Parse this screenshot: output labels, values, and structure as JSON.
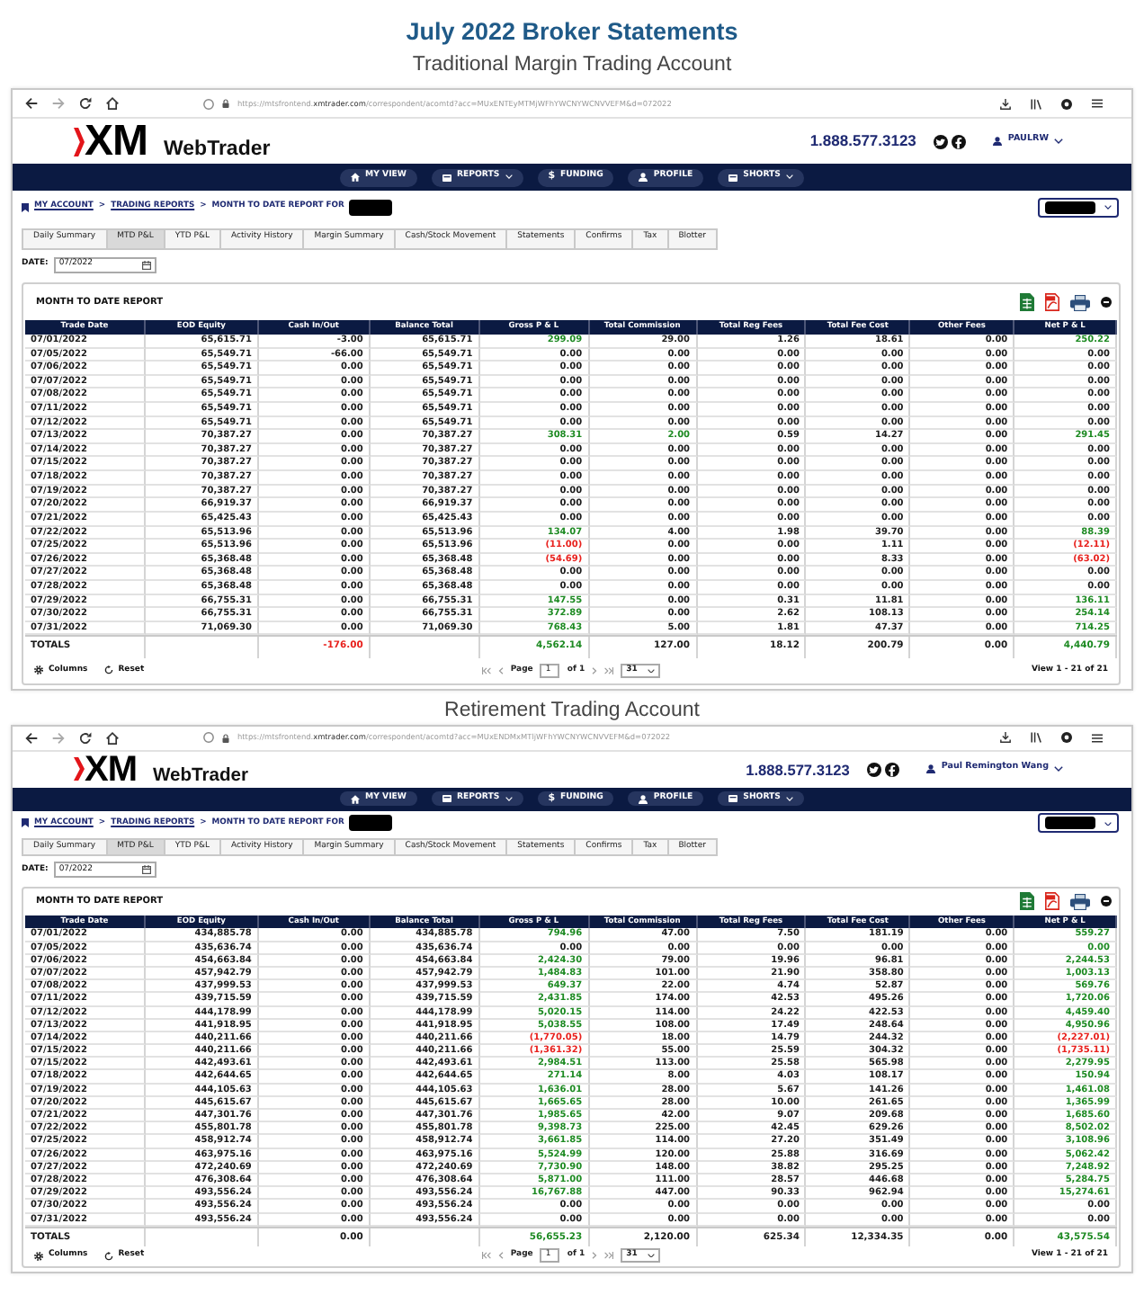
{
  "heading": "July 2022 Broker Statements",
  "statements": [
    {
      "caption": "Traditional Margin Trading Account",
      "browser": {
        "url_host": "https://mtsfrontend.",
        "url_domain": "xmtrader.com",
        "url_path": "/correspondent/acomtd?acc=MUxENTEyMTMjWFhYWCNYWCNVVEFM&d=072022"
      },
      "site": {
        "brand": "XM",
        "product": "WebTrader",
        "phone": "1.888.577.3123",
        "user": "PAULRW"
      },
      "nav": [
        {
          "label": "MY VIEW",
          "dropdown": false
        },
        {
          "label": "REPORTS",
          "dropdown": true
        },
        {
          "label": "FUNDING",
          "glyph": "$",
          "dropdown": false
        },
        {
          "label": "PROFILE",
          "dropdown": false
        },
        {
          "label": "SHORTS",
          "dropdown": true
        }
      ],
      "breadcrumb": [
        {
          "kind": "link",
          "text": "MY ACCOUNT"
        },
        {
          "kind": "separator",
          "text": ">"
        },
        {
          "kind": "link",
          "text": "TRADING REPORTS"
        },
        {
          "kind": "separator",
          "text": ">"
        },
        {
          "kind": "text",
          "text": "MONTH TO DATE REPORT FOR"
        }
      ],
      "tabs": [
        {
          "label": "Daily Summary",
          "selected": false
        },
        {
          "label": "MTD P&L",
          "selected": true
        },
        {
          "label": "YTD P&L",
          "selected": false
        },
        {
          "label": "Activity History",
          "selected": false
        },
        {
          "label": "Margin Summary",
          "selected": false
        },
        {
          "label": "Cash/Stock Movement",
          "selected": false
        },
        {
          "label": "Statements",
          "selected": false
        },
        {
          "label": "Confirms",
          "selected": false
        },
        {
          "label": "Tax",
          "selected": false
        },
        {
          "label": "Blotter",
          "selected": false
        }
      ],
      "date": {
        "label": "DATE:",
        "value": "07/2022"
      },
      "report": {
        "title": "MONTH TO DATE REPORT",
        "columns": [
          "Trade Date",
          "EOD Equity",
          "Cash In/Out",
          "Balance Total",
          "Gross P & L",
          "Total Commission",
          "Total Reg Fees",
          "Total Fee Cost",
          "Other Fees",
          "Net P & L"
        ],
        "rows": [
          [
            "07/01/2022",
            "65,615.71",
            "-3.00",
            "65,615.71",
            {
              "text": "299.09",
              "color": "#1d8a22"
            },
            "29.00",
            "1.26",
            "18.61",
            "0.00",
            {
              "text": "250.22",
              "color": "#1d8a22"
            }
          ],
          [
            "07/05/2022",
            "65,549.71",
            "-66.00",
            "65,549.71",
            "0.00",
            "0.00",
            "0.00",
            "0.00",
            "0.00",
            "0.00"
          ],
          [
            "07/06/2022",
            "65,549.71",
            "0.00",
            "65,549.71",
            "0.00",
            "0.00",
            "0.00",
            "0.00",
            "0.00",
            "0.00"
          ],
          [
            "07/07/2022",
            "65,549.71",
            "0.00",
            "65,549.71",
            "0.00",
            "0.00",
            "0.00",
            "0.00",
            "0.00",
            "0.00"
          ],
          [
            "07/08/2022",
            "65,549.71",
            "0.00",
            "65,549.71",
            "0.00",
            "0.00",
            "0.00",
            "0.00",
            "0.00",
            "0.00"
          ],
          [
            "07/11/2022",
            "65,549.71",
            "0.00",
            "65,549.71",
            "0.00",
            "0.00",
            "0.00",
            "0.00",
            "0.00",
            "0.00"
          ],
          [
            "07/12/2022",
            "65,549.71",
            "0.00",
            "65,549.71",
            "0.00",
            "0.00",
            "0.00",
            "0.00",
            "0.00",
            "0.00"
          ],
          [
            "07/13/2022",
            "70,387.27",
            "0.00",
            "70,387.27",
            {
              "text": "308.31",
              "color": "#1d8a22"
            },
            {
              "text": "2.00",
              "color": "#1d8a22"
            },
            "0.59",
            "14.27",
            "0.00",
            {
              "text": "291.45",
              "color": "#1d8a22"
            }
          ],
          [
            "07/14/2022",
            "70,387.27",
            "0.00",
            "70,387.27",
            "0.00",
            "0.00",
            "0.00",
            "0.00",
            "0.00",
            "0.00"
          ],
          [
            "07/15/2022",
            "70,387.27",
            "0.00",
            "70,387.27",
            "0.00",
            "0.00",
            "0.00",
            "0.00",
            "0.00",
            "0.00"
          ],
          [
            "07/18/2022",
            "70,387.27",
            "0.00",
            "70,387.27",
            "0.00",
            "0.00",
            "0.00",
            "0.00",
            "0.00",
            "0.00"
          ],
          [
            "07/19/2022",
            "70,387.27",
            "0.00",
            "70,387.27",
            "0.00",
            "0.00",
            "0.00",
            "0.00",
            "0.00",
            "0.00"
          ],
          [
            "07/20/2022",
            "66,919.37",
            "0.00",
            "66,919.37",
            "0.00",
            "0.00",
            "0.00",
            "0.00",
            "0.00",
            "0.00"
          ],
          [
            "07/21/2022",
            "65,425.43",
            "0.00",
            "65,425.43",
            "0.00",
            "0.00",
            "0.00",
            "0.00",
            "0.00",
            "0.00"
          ],
          [
            "07/22/2022",
            "65,513.96",
            "0.00",
            "65,513.96",
            {
              "text": "134.07",
              "color": "#1d8a22"
            },
            "4.00",
            "1.98",
            "39.70",
            "0.00",
            {
              "text": "88.39",
              "color": "#1d8a22"
            }
          ],
          [
            "07/25/2022",
            "65,513.96",
            "0.00",
            "65,513.96",
            {
              "text": "(11.00)",
              "color": "#e8211d"
            },
            "0.00",
            "0.00",
            "1.11",
            "0.00",
            {
              "text": "(12.11)",
              "color": "#e8211d"
            }
          ],
          [
            "07/26/2022",
            "65,368.48",
            "0.00",
            "65,368.48",
            {
              "text": "(54.69)",
              "color": "#e8211d"
            },
            "0.00",
            "0.00",
            "8.33",
            "0.00",
            {
              "text": "(63.02)",
              "color": "#e8211d"
            }
          ],
          [
            "07/27/2022",
            "65,368.48",
            "0.00",
            "65,368.48",
            "0.00",
            "0.00",
            "0.00",
            "0.00",
            "0.00",
            "0.00"
          ],
          [
            "07/28/2022",
            "65,368.48",
            "0.00",
            "65,368.48",
            "0.00",
            "0.00",
            "0.00",
            "0.00",
            "0.00",
            "0.00"
          ],
          [
            "07/29/2022",
            "66,755.31",
            "0.00",
            "66,755.31",
            {
              "text": "147.55",
              "color": "#1d8a22"
            },
            "0.00",
            "0.31",
            "11.81",
            "0.00",
            {
              "text": "136.11",
              "color": "#1d8a22"
            }
          ],
          [
            "07/30/2022",
            "66,755.31",
            "0.00",
            "66,755.31",
            {
              "text": "372.89",
              "color": "#1d8a22"
            },
            "0.00",
            "2.62",
            "108.13",
            "0.00",
            {
              "text": "254.14",
              "color": "#1d8a22"
            }
          ],
          [
            "07/31/2022",
            "71,069.30",
            "0.00",
            "71,069.30",
            {
              "text": "768.43",
              "color": "#1d8a22"
            },
            "5.00",
            "1.81",
            "47.37",
            "0.00",
            {
              "text": "714.25",
              "color": "#1d8a22"
            }
          ]
        ],
        "totals": {
          "label": "TOTALS",
          "cells": [
            null,
            {
              "text": "-176.00",
              "color": "#e8211d"
            },
            null,
            {
              "text": "4,562.14",
              "color": "#1d8a22"
            },
            "127.00",
            "18.12",
            "200.79",
            "0.00",
            {
              "text": "4,440.79",
              "color": "#1d8a22"
            }
          ]
        }
      },
      "pager": {
        "columns": "Columns",
        "reset": "Reset",
        "page_label": "Page",
        "page": "1",
        "page_count": "of 1",
        "page_size": "31",
        "summary": "View 1 - 21 of 21"
      }
    },
    {
      "caption": "Retirement Trading Account",
      "browser": {
        "url_host": "https://mtsfrontend.",
        "url_domain": "xmtrader.com",
        "url_path": "/correspondent/acomtd?acc=MUxENDMxMTljWFhYWCNYWCNVVEFM&d=072022"
      },
      "site": {
        "brand": "XM",
        "product": "WebTrader",
        "phone": "1.888.577.3123",
        "user": "Paul Remington Wang"
      },
      "nav": [
        {
          "label": "MY VIEW",
          "dropdown": false
        },
        {
          "label": "REPORTS",
          "dropdown": true
        },
        {
          "label": "FUNDING",
          "glyph": "$",
          "dropdown": false
        },
        {
          "label": "PROFILE",
          "dropdown": false
        },
        {
          "label": "SHORTS",
          "dropdown": true
        }
      ],
      "breadcrumb": [
        {
          "kind": "link",
          "text": "MY ACCOUNT"
        },
        {
          "kind": "separator",
          "text": ">"
        },
        {
          "kind": "link",
          "text": "TRADING REPORTS"
        },
        {
          "kind": "separator",
          "text": ">"
        },
        {
          "kind": "text",
          "text": "MONTH TO DATE REPORT FOR"
        }
      ],
      "tabs": [
        {
          "label": "Daily Summary",
          "selected": false
        },
        {
          "label": "MTD P&L",
          "selected": true
        },
        {
          "label": "YTD P&L",
          "selected": false
        },
        {
          "label": "Activity History",
          "selected": false
        },
        {
          "label": "Margin Summary",
          "selected": false
        },
        {
          "label": "Cash/Stock Movement",
          "selected": false
        },
        {
          "label": "Statements",
          "selected": false
        },
        {
          "label": "Confirms",
          "selected": false
        },
        {
          "label": "Tax",
          "selected": false
        },
        {
          "label": "Blotter",
          "selected": false
        }
      ],
      "date": {
        "label": "DATE:",
        "value": "07/2022"
      },
      "report": {
        "title": "MONTH TO DATE REPORT",
        "columns": [
          "Trade Date",
          "EOD Equity",
          "Cash In/Out",
          "Balance Total",
          "Gross P & L",
          "Total Commission",
          "Total Reg Fees",
          "Total Fee Cost",
          "Other Fees",
          "Net P & L"
        ],
        "rows": [
          [
            "07/01/2022",
            "434,885.78",
            "0.00",
            "434,885.78",
            {
              "text": "794.96",
              "color": "#1d8a22"
            },
            "47.00",
            "7.50",
            "181.19",
            "0.00",
            {
              "text": "559.27",
              "color": "#1d8a22"
            }
          ],
          [
            "07/05/2022",
            "435,636.74",
            "0.00",
            "435,636.74",
            "0.00",
            "0.00",
            "0.00",
            "0.00",
            "0.00",
            {
              "text": "0.00",
              "color": "#1d8a22"
            }
          ],
          [
            "07/06/2022",
            "454,663.84",
            "0.00",
            "454,663.84",
            {
              "text": "2,424.30",
              "color": "#1d8a22"
            },
            "79.00",
            "19.96",
            "96.81",
            "0.00",
            {
              "text": "2,244.53",
              "color": "#1d8a22"
            }
          ],
          [
            "07/07/2022",
            "457,942.79",
            "0.00",
            "457,942.79",
            {
              "text": "1,484.83",
              "color": "#1d8a22"
            },
            "101.00",
            "21.90",
            "358.80",
            "0.00",
            {
              "text": "1,003.13",
              "color": "#1d8a22"
            }
          ],
          [
            "07/08/2022",
            "437,999.53",
            "0.00",
            "437,999.53",
            {
              "text": "649.37",
              "color": "#1d8a22"
            },
            "22.00",
            "4.74",
            "52.87",
            "0.00",
            {
              "text": "569.76",
              "color": "#1d8a22"
            }
          ],
          [
            "07/11/2022",
            "439,715.59",
            "0.00",
            "439,715.59",
            {
              "text": "2,431.85",
              "color": "#1d8a22"
            },
            "174.00",
            "42.53",
            "495.26",
            "0.00",
            {
              "text": "1,720.06",
              "color": "#1d8a22"
            }
          ],
          [
            "07/12/2022",
            "444,178.99",
            "0.00",
            "444,178.99",
            {
              "text": "5,020.15",
              "color": "#1d8a22"
            },
            "114.00",
            "24.22",
            "422.53",
            "0.00",
            {
              "text": "4,459.40",
              "color": "#1d8a22"
            }
          ],
          [
            "07/13/2022",
            "441,918.95",
            "0.00",
            "441,918.95",
            {
              "text": "5,038.55",
              "color": "#1d8a22"
            },
            "108.00",
            "17.49",
            "248.64",
            "0.00",
            {
              "text": "4,950.96",
              "color": "#1d8a22"
            }
          ],
          [
            "07/14/2022",
            "440,211.66",
            "0.00",
            "440,211.66",
            {
              "text": "(1,770.05)",
              "color": "#e8211d"
            },
            "18.00",
            "14.79",
            "244.32",
            "0.00",
            {
              "text": "(2,227.01)",
              "color": "#e8211d"
            }
          ],
          [
            "07/15/2022",
            "440,211.66",
            "0.00",
            "440,211.66",
            {
              "text": "(1,361.32)",
              "color": "#e8211d"
            },
            "55.00",
            "25.59",
            "304.32",
            "0.00",
            {
              "text": "(1,735.11)",
              "color": "#e8211d"
            }
          ],
          [
            "07/15/2022",
            "442,493.61",
            "0.00",
            "442,493.61",
            {
              "text": "2,984.51",
              "color": "#1d8a22"
            },
            "113.00",
            "25.58",
            "565.98",
            "0.00",
            {
              "text": "2,279.95",
              "color": "#1d8a22"
            }
          ],
          [
            "07/18/2022",
            "442,644.65",
            "0.00",
            "442,644.65",
            {
              "text": "271.14",
              "color": "#1d8a22"
            },
            "8.00",
            "4.03",
            "108.17",
            "0.00",
            {
              "text": "150.94",
              "color": "#1d8a22"
            }
          ],
          [
            "07/19/2022",
            "444,105.63",
            "0.00",
            "444,105.63",
            {
              "text": "1,636.01",
              "color": "#1d8a22"
            },
            "28.00",
            "5.67",
            "141.26",
            "0.00",
            {
              "text": "1,461.08",
              "color": "#1d8a22"
            }
          ],
          [
            "07/20/2022",
            "445,615.67",
            "0.00",
            "445,615.67",
            {
              "text": "1,665.65",
              "color": "#1d8a22"
            },
            "28.00",
            "10.00",
            "261.65",
            "0.00",
            {
              "text": "1,365.99",
              "color": "#1d8a22"
            }
          ],
          [
            "07/21/2022",
            "447,301.76",
            "0.00",
            "447,301.76",
            {
              "text": "1,985.65",
              "color": "#1d8a22"
            },
            "42.00",
            "9.07",
            "209.68",
            "0.00",
            {
              "text": "1,685.60",
              "color": "#1d8a22"
            }
          ],
          [
            "07/22/2022",
            "455,801.78",
            "0.00",
            "455,801.78",
            {
              "text": "9,398.73",
              "color": "#1d8a22"
            },
            "225.00",
            "42.45",
            "629.26",
            "0.00",
            {
              "text": "8,502.02",
              "color": "#1d8a22"
            }
          ],
          [
            "07/25/2022",
            "458,912.74",
            "0.00",
            "458,912.74",
            {
              "text": "3,661.85",
              "color": "#1d8a22"
            },
            "114.00",
            "27.20",
            "351.49",
            "0.00",
            {
              "text": "3,108.96",
              "color": "#1d8a22"
            }
          ],
          [
            "07/26/2022",
            "463,975.16",
            "0.00",
            "463,975.16",
            {
              "text": "5,524.99",
              "color": "#1d8a22"
            },
            "120.00",
            "25.88",
            "316.69",
            "0.00",
            {
              "text": "5,062.42",
              "color": "#1d8a22"
            }
          ],
          [
            "07/27/2022",
            "472,240.69",
            "0.00",
            "472,240.69",
            {
              "text": "7,730.90",
              "color": "#1d8a22"
            },
            "148.00",
            "38.82",
            "295.25",
            "0.00",
            {
              "text": "7,248.92",
              "color": "#1d8a22"
            }
          ],
          [
            "07/28/2022",
            "476,308.64",
            "0.00",
            "476,308.64",
            {
              "text": "5,871.00",
              "color": "#1d8a22"
            },
            "111.00",
            "28.57",
            "446.68",
            "0.00",
            {
              "text": "5,284.75",
              "color": "#1d8a22"
            }
          ],
          [
            "07/29/2022",
            "493,556.24",
            "0.00",
            "493,556.24",
            {
              "text": "16,767.88",
              "color": "#1d8a22"
            },
            "447.00",
            "90.33",
            "962.94",
            "0.00",
            {
              "text": "15,274.61",
              "color": "#1d8a22"
            }
          ],
          [
            "07/30/2022",
            "493,556.24",
            "0.00",
            "493,556.24",
            "0.00",
            "0.00",
            "0.00",
            "0.00",
            "0.00",
            "0.00"
          ],
          [
            "07/31/2022",
            "493,556.24",
            "0.00",
            "493,556.24",
            "0.00",
            "0.00",
            "0.00",
            "0.00",
            "0.00",
            "0.00"
          ]
        ],
        "totals": {
          "label": "TOTALS",
          "cells": [
            null,
            "0.00",
            null,
            {
              "text": "56,655.23",
              "color": "#1d8a22"
            },
            "2,120.00",
            "625.34",
            "12,334.35",
            "0.00",
            {
              "text": "43,575.54",
              "color": "#1d8a22"
            }
          ]
        }
      },
      "pager": {
        "columns": "Columns",
        "reset": "Reset",
        "page_label": "Page",
        "page": "1",
        "page_count": "of 1",
        "page_size": "31",
        "summary": "View 1 - 21 of 21"
      }
    }
  ]
}
